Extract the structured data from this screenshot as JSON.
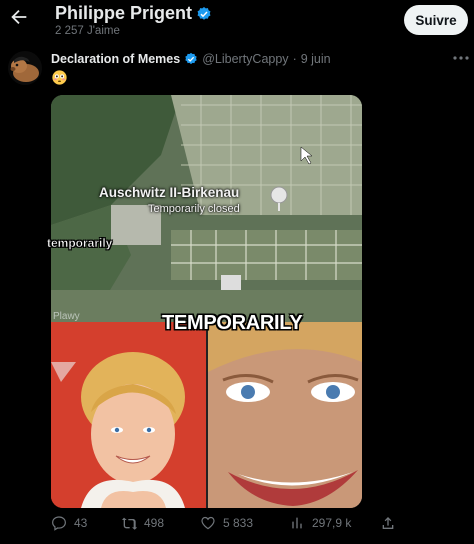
{
  "header": {
    "name": "Philippe Prigent",
    "likes_count": "2 257 J'aime",
    "follow_label": "Suivre"
  },
  "tweet": {
    "author_name": "Declaration of Memes",
    "handle": "@LibertyCappy",
    "separator": "·",
    "date": "9 juin",
    "emoji": "flushed-face"
  },
  "media": {
    "place_name": "Auschwitz II-Birkenau",
    "place_status": "Temporarily closed",
    "watermark": "Plawy",
    "caption_small": "temporarily",
    "caption_big": "TEMPORARILY"
  },
  "actions": {
    "replies": "43",
    "reposts": "498",
    "likes": "5 833",
    "views": "297,9 k"
  },
  "colors": {
    "background": "#000000",
    "text": "#e7e9ea",
    "muted": "#71767b",
    "verified": "#1d9bf0",
    "follow_bg": "#eff3f4"
  }
}
